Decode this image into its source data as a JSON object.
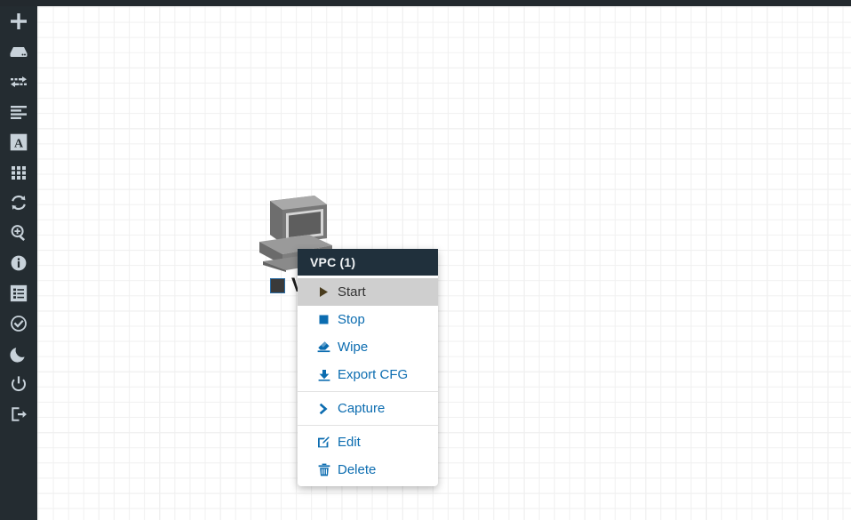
{
  "app": {
    "topbar_color": "#23292e",
    "sidebar_color": "#242c31",
    "accent_color": "#0b6cb0",
    "canvas_bg": "#ffffff",
    "grid_line_color": "#f0f0f0"
  },
  "sidebar": {
    "items": [
      {
        "name": "add-node-button",
        "icon": "plus-icon"
      },
      {
        "name": "add-network-button",
        "icon": "server-icon"
      },
      {
        "name": "link-nodes-button",
        "icon": "exchange-arrows-icon"
      },
      {
        "name": "align-button",
        "icon": "align-left-icon"
      },
      {
        "name": "add-text-button",
        "icon": "text-box-icon"
      },
      {
        "name": "grid-toggle-button",
        "icon": "grid-icon"
      },
      {
        "name": "refresh-button",
        "icon": "sync-icon"
      },
      {
        "name": "zoom-button",
        "icon": "search-plus-icon"
      },
      {
        "name": "info-button",
        "icon": "info-circle-icon"
      },
      {
        "name": "list-button",
        "icon": "list-table-icon"
      },
      {
        "name": "status-button",
        "icon": "check-circle-icon"
      },
      {
        "name": "dark-mode-button",
        "icon": "moon-icon"
      },
      {
        "name": "power-button",
        "icon": "power-icon"
      },
      {
        "name": "logout-button",
        "icon": "sign-out-icon"
      }
    ]
  },
  "node": {
    "icon": "desktop-pc-icon",
    "label": "VPC",
    "status_color": "#3a3a3a",
    "status_border": "#2b6ca3"
  },
  "context_menu": {
    "title": "VPC (1)",
    "groups": [
      {
        "items": [
          {
            "label": "Start",
            "icon": "play-icon",
            "name": "menu-item-start",
            "active": true
          },
          {
            "label": "Stop",
            "icon": "stop-icon",
            "name": "menu-item-stop",
            "active": false
          },
          {
            "label": "Wipe",
            "icon": "eraser-icon",
            "name": "menu-item-wipe",
            "active": false
          },
          {
            "label": "Export CFG",
            "icon": "download-icon",
            "name": "menu-item-export-cfg",
            "active": false
          }
        ]
      },
      {
        "items": [
          {
            "label": "Capture",
            "icon": "chevron-right-icon",
            "name": "menu-item-capture",
            "active": false
          }
        ]
      },
      {
        "items": [
          {
            "label": "Edit",
            "icon": "pencil-square-icon",
            "name": "menu-item-edit",
            "active": false
          },
          {
            "label": "Delete",
            "icon": "trash-icon",
            "name": "menu-item-delete",
            "active": false
          }
        ]
      }
    ]
  }
}
